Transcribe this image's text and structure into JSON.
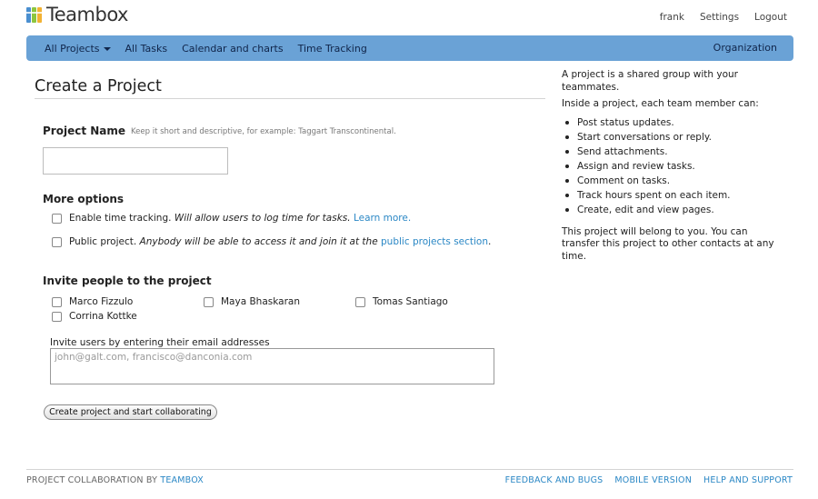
{
  "brand": {
    "name": "Teambox",
    "logo_icon": "teambox-logo-icon"
  },
  "top_links": {
    "user": "frank",
    "settings": "Settings",
    "logout": "Logout"
  },
  "nav": {
    "all_projects": "All Projects",
    "all_tasks": "All Tasks",
    "calendar": "Calendar and charts",
    "time_tracking": "Time Tracking",
    "organization": "Organization",
    "bar_color": "#6aa2d6"
  },
  "form": {
    "title": "Create a Project",
    "project_name_label": "Project Name",
    "project_name_hint": "Keep it short and descriptive, for example: Taggart Transcontinental.",
    "project_name_value": "",
    "more_options_label": "More options",
    "time_tracking": {
      "label": "Enable time tracking.",
      "note": "Will allow users to log time for tasks.",
      "link": "Learn more."
    },
    "public_project": {
      "label": "Public project.",
      "note": "Anybody will be able to access it and join it at the",
      "link": "public projects section",
      "suffix": "."
    },
    "invite_label": "Invite people to the project",
    "people": [
      "Marco Fizzulo",
      "Maya Bhaskaran",
      "Tomas Santiago",
      "Corrina Kottke"
    ],
    "email_label": "Invite users by entering their email addresses",
    "email_placeholder": "john@galt.com, francisco@danconia.com",
    "submit_label": "Create project and start collaborating"
  },
  "sidebar": {
    "intro": "A project is a shared group with your teammates.",
    "list_heading": "Inside a project, each team member can:",
    "capabilities": [
      "Post status updates.",
      "Start conversations or reply.",
      "Send attachments.",
      "Assign and review tasks.",
      "Comment on tasks.",
      "Track hours spent on each item.",
      "Create, edit and view pages."
    ],
    "ownership": "This project will belong to you. You can transfer this project to other contacts at any time."
  },
  "footer": {
    "prefix": "PROJECT COLLABORATION BY",
    "brand_link": "TEAMBOX",
    "feedback": "FEEDBACK AND BUGS",
    "mobile": "MOBILE VERSION",
    "help": "HELP AND SUPPORT"
  },
  "colors": {
    "link": "#2a87c5",
    "nav_bar": "#6aa2d6"
  }
}
